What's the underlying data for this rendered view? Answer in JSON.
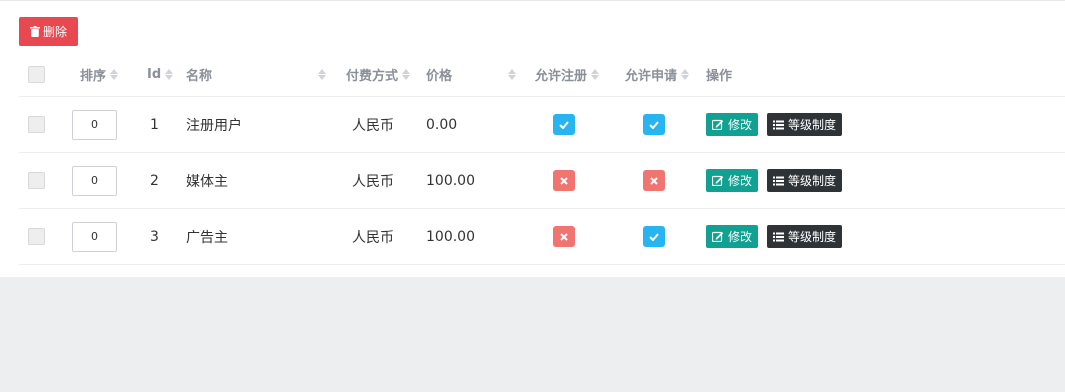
{
  "toolbar": {
    "delete_label": "删除"
  },
  "table": {
    "headers": {
      "sort": "排序",
      "id": "Id",
      "name": "名称",
      "payment": "付费方式",
      "price": "价格",
      "allow_register": "允许注册",
      "allow_apply": "允许申请",
      "actions": "操作"
    },
    "rows": [
      {
        "sort": "0",
        "id": "1",
        "name": "注册用户",
        "payment": "人民币",
        "price": "0.00",
        "allow_register": true,
        "allow_apply": true
      },
      {
        "sort": "0",
        "id": "2",
        "name": "媒体主",
        "payment": "人民币",
        "price": "100.00",
        "allow_register": false,
        "allow_apply": false
      },
      {
        "sort": "0",
        "id": "3",
        "name": "广告主",
        "payment": "人民币",
        "price": "100.00",
        "allow_register": false,
        "allow_apply": true
      }
    ],
    "actions": {
      "edit_label": "修改",
      "level_label": "等级制度"
    }
  },
  "colors": {
    "delete": "#e84850",
    "yes": "#28b4f0",
    "no": "#f07470",
    "edit": "#11a192",
    "level": "#2e3338"
  }
}
